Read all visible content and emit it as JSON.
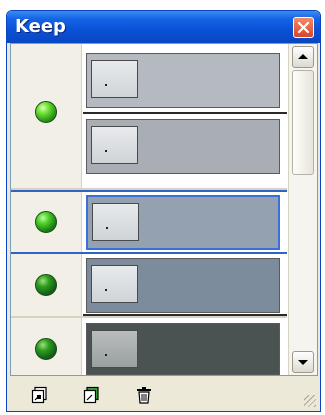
{
  "window": {
    "title": "Keep"
  },
  "groups": [
    {
      "led": "bright",
      "selected": false,
      "cards": [
        {
          "fill": "#b5bac0",
          "selected": false
        },
        {
          "fill": "#a8aeb4",
          "selected": false
        }
      ]
    },
    {
      "led": "mid",
      "selected": true,
      "cards": [
        {
          "fill": "#93a1b0",
          "selected": true
        }
      ]
    },
    {
      "led": "dark",
      "selected": false,
      "cards": [
        {
          "fill": "#7d8c9c",
          "selected": false
        }
      ]
    },
    {
      "led": "dark",
      "selected": false,
      "cards": [
        {
          "fill": "#4a5252",
          "selected": false
        }
      ]
    }
  ],
  "toolbar": {
    "icons": [
      "new-note-icon",
      "new-group-icon",
      "trash-icon"
    ]
  },
  "colors": {
    "titlebar": "#0a50d6",
    "selection": "#2f63c7",
    "panel": "#ece9d8"
  }
}
